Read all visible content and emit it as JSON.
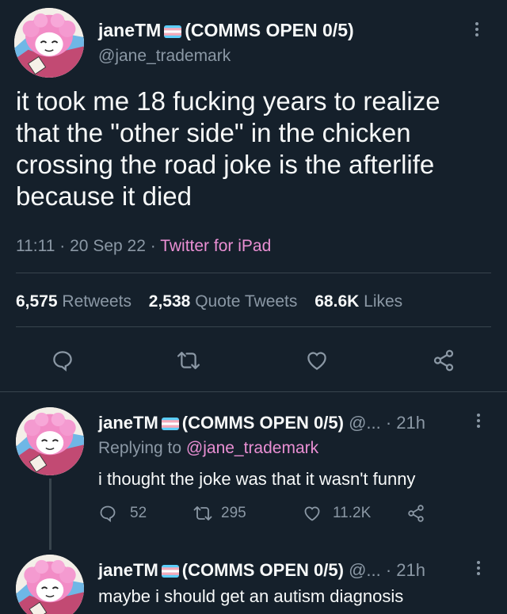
{
  "main_tweet": {
    "display_name": "janeTM",
    "display_name_suffix": "(COMMS OPEN 0/5)",
    "handle": "@jane_trademark",
    "text_lines": [
      "it took me 18 fucking years to realize",
      "that the \"other side\" in the chicken",
      "crossing the road joke is the afterlife",
      "because it died"
    ],
    "time": "11:11",
    "date": "20 Sep 22",
    "separator": "·",
    "source": "Twitter for iPad",
    "stats": {
      "retweets_count": "6,575",
      "retweets_label": "Retweets",
      "quotes_count": "2,538",
      "quotes_label": "Quote Tweets",
      "likes_count": "68.6K",
      "likes_label": "Likes"
    },
    "icons": [
      "reply-icon",
      "retweet-icon",
      "like-icon",
      "share-icon"
    ]
  },
  "replies": [
    {
      "display_name": "janeTM",
      "display_name_suffix": "(COMMS OPEN 0/5)",
      "handle_truncated": "@...",
      "time": "· 21h",
      "replying_prefix": "Replying to",
      "replying_handle": "@jane_trademark",
      "text": "i thought the joke was that it wasn't funny",
      "reply_count": "52",
      "retweet_count": "295",
      "like_count": "11.2K"
    },
    {
      "display_name": "janeTM",
      "display_name_suffix": "(COMMS OPEN 0/5)",
      "handle_truncated": "@...",
      "time": "· 21h",
      "text": "maybe i should get an autism diagnosis"
    }
  ],
  "colors": {
    "background": "#15202b",
    "text": "#f7f9f9",
    "secondary": "#8b98a5",
    "link": "#e98fd3",
    "divider": "#38444d"
  }
}
